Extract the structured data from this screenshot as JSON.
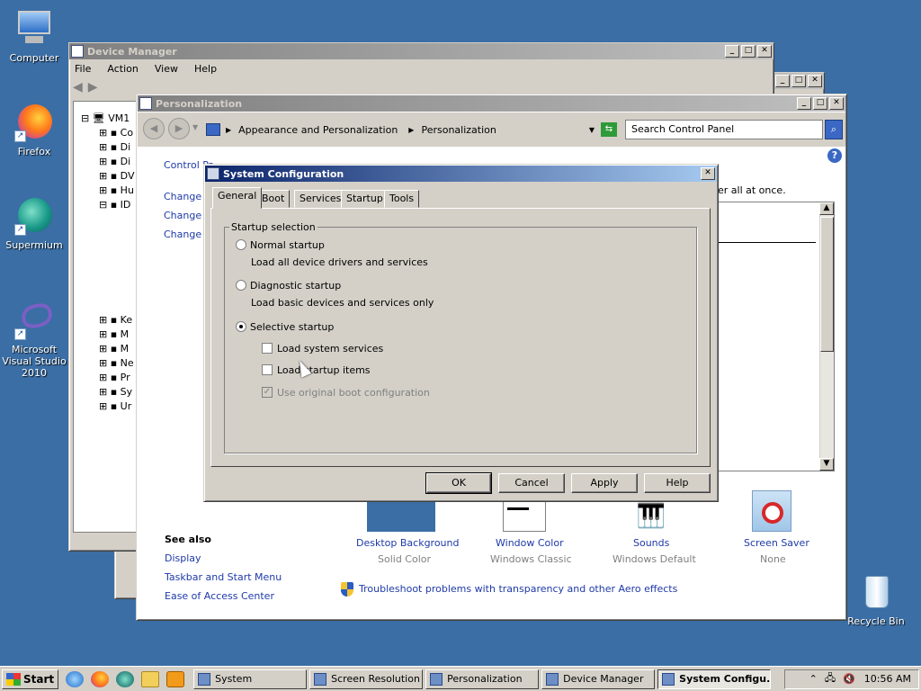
{
  "desktop": {
    "icons": [
      {
        "label": "Computer"
      },
      {
        "label": "Firefox"
      },
      {
        "label": "Supermium"
      },
      {
        "label": "Microsoft Visual Studio 2010"
      },
      {
        "label": "Recycle Bin"
      }
    ]
  },
  "device_manager": {
    "title": "Device Manager",
    "menu": [
      "File",
      "Action",
      "View",
      "Help"
    ],
    "tree_root": "VM1",
    "tree_items": [
      "Co",
      "Di",
      "Di",
      "DV",
      "Hu",
      "ID",
      "Ke",
      "M",
      "M",
      "Ne",
      "Pr",
      "Sy",
      "Ur"
    ]
  },
  "personalization": {
    "title": "Personalization",
    "breadcrumb": [
      "Appearance and Personalization",
      "Personalization"
    ],
    "search_placeholder": "Search Control Panel",
    "left_links": [
      "Control Pa",
      "Change c",
      "Change r",
      "Change y"
    ],
    "right_fragment": "er all at once.",
    "see_also_title": "See also",
    "see_also": [
      "Display",
      "Taskbar and Start Menu",
      "Ease of Access Center"
    ],
    "items": [
      {
        "label": "Desktop Background",
        "value": "Solid Color"
      },
      {
        "label": "Window Color",
        "value": "Windows Classic"
      },
      {
        "label": "Sounds",
        "value": "Windows Default"
      },
      {
        "label": "Screen Saver",
        "value": "None"
      }
    ],
    "troubleshoot": "Troubleshoot problems with transparency and other Aero effects"
  },
  "sysconfig": {
    "title": "System Configuration",
    "tabs": [
      "General",
      "Boot",
      "Services",
      "Startup",
      "Tools"
    ],
    "group_label": "Startup selection",
    "normal": {
      "label": "Normal startup",
      "desc": "Load all device drivers and services"
    },
    "diagnostic": {
      "label": "Diagnostic startup",
      "desc": "Load basic devices and services only"
    },
    "selective": {
      "label": "Selective startup"
    },
    "options": {
      "system_services": "Load system services",
      "startup_items": "Load startup items",
      "original_boot": "Use original boot configuration"
    },
    "buttons": {
      "ok": "OK",
      "cancel": "Cancel",
      "apply": "Apply",
      "help": "Help"
    }
  },
  "taskbar": {
    "start": "Start",
    "tasks": [
      "System",
      "Screen Resolution",
      "Personalization",
      "Device Manager",
      "System Configu..."
    ],
    "clock": "10:56 AM"
  }
}
